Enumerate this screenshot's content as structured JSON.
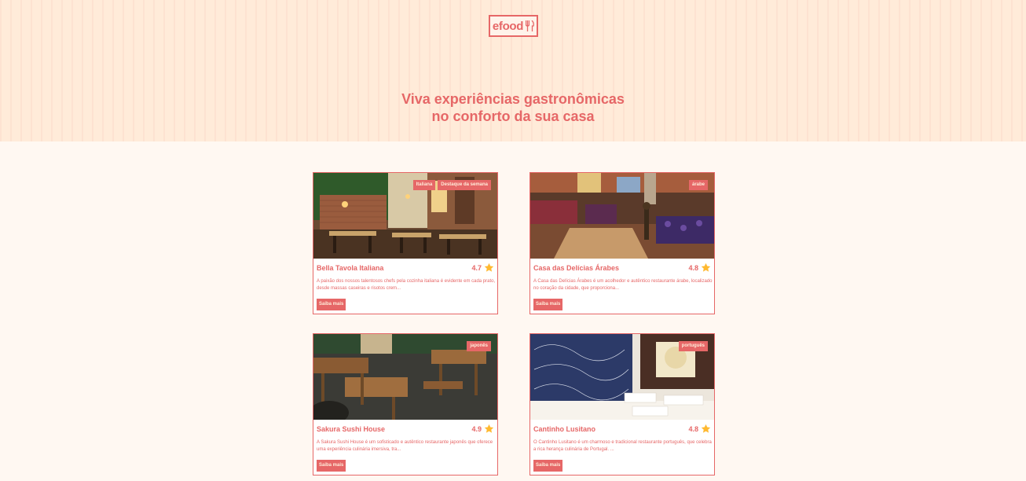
{
  "header": {
    "logo_text": "efood",
    "title_line1": "Viva experiências gastronômicas",
    "title_line2": "no conforto da sua casa"
  },
  "restaurants": [
    {
      "name": "Bella Tavola Italiana",
      "rating": "4.7",
      "tags": [
        "Italiana",
        "Destaque da semana"
      ],
      "description": "A paixão dos nossos talentosos chefs pela cozinha italiana é evidente em cada prato, desde massas caseiras e risotos crem...",
      "button": "Saiba mais"
    },
    {
      "name": "Casa das Delícias Árabes",
      "rating": "4.8",
      "tags": [
        "árabe"
      ],
      "description": "A Casa das Delícias Árabes é um acolhedor e autêntico restaurante árabe, localizado no coração da cidade, que proporciona...",
      "button": "Saiba mais"
    },
    {
      "name": "Sakura Sushi House",
      "rating": "4.9",
      "tags": [
        "japonês"
      ],
      "description": "A Sakura Sushi House é um sofisticado e autêntico restaurante japonês que oferece uma experiência culinária imersiva, tra...",
      "button": "Saiba mais"
    },
    {
      "name": "Cantinho Lusitano",
      "rating": "4.8",
      "tags": [
        "português"
      ],
      "description": "O Cantinho Lusitano é um charmoso e tradicional restaurante português, que celebra a rica herança culinária de Portugal. ...",
      "button": "Saiba mais"
    }
  ],
  "colors": {
    "accent": "#e66767",
    "hero_bg": "#ffebd9",
    "page_bg": "#fff8f2"
  }
}
